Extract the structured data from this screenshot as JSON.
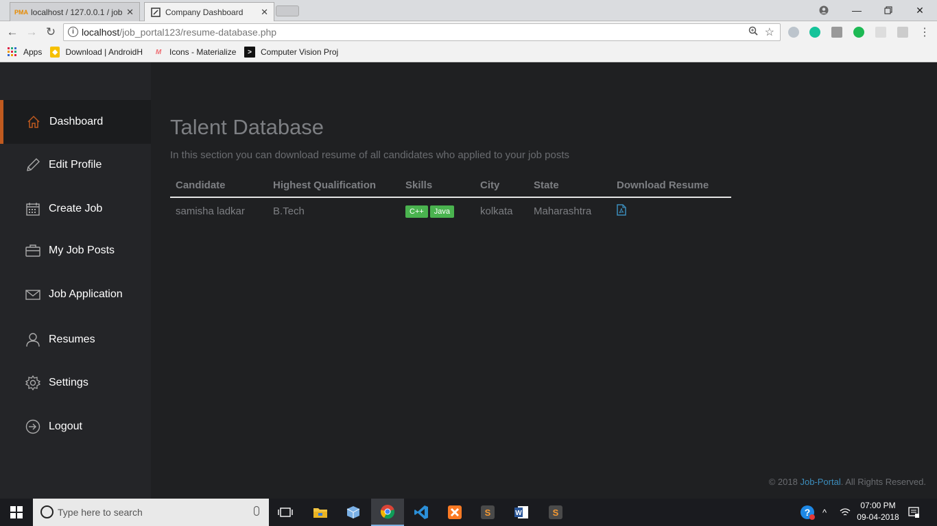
{
  "browser": {
    "tabs": [
      {
        "title": "localhost / 127.0.0.1 / job",
        "favicon": "PMA"
      },
      {
        "title": "Company Dashboard",
        "favicon": "page-icon"
      }
    ],
    "url_host": "localhost",
    "url_path": "/job_portal123/resume-database.php",
    "bookmarks": [
      {
        "label": "Apps"
      },
      {
        "label": "Download | AndroidH"
      },
      {
        "label": "Icons - Materialize"
      },
      {
        "label": "Computer Vision Proj"
      }
    ]
  },
  "sidebar": {
    "items": [
      {
        "label": "Dashboard",
        "icon": "home-icon"
      },
      {
        "label": "Edit Profile",
        "icon": "pencil-icon"
      },
      {
        "label": "Create Job",
        "icon": "calendar-icon"
      },
      {
        "label": "My Job Posts",
        "icon": "briefcase-icon"
      },
      {
        "label": "Job Application",
        "icon": "envelope-icon"
      },
      {
        "label": "Resumes",
        "icon": "user-icon"
      },
      {
        "label": "Settings",
        "icon": "gear-icon"
      },
      {
        "label": "Logout",
        "icon": "logout-icon"
      }
    ],
    "active_color": "#c05a1f"
  },
  "main": {
    "title": "Talent Database",
    "subtitle": "In this section you can download resume of all candidates who applied to your job posts",
    "table": {
      "headers": [
        "Candidate",
        "Highest Qualification",
        "Skills",
        "City",
        "State",
        "Download Resume"
      ],
      "rows": [
        {
          "candidate": "samisha ladkar",
          "qualification": "B.Tech",
          "skills": [
            "C++",
            "Java"
          ],
          "city": "kolkata",
          "state": "Maharashtra",
          "download_icon": "pdf-file-icon"
        }
      ]
    }
  },
  "footer": {
    "prefix": "© 2018 ",
    "link": "Job-Portal",
    "suffix": ". All Rights Reserved."
  },
  "taskbar": {
    "search_placeholder": "Type here to search",
    "time": "07:00 PM",
    "date": "09-04-2018"
  }
}
